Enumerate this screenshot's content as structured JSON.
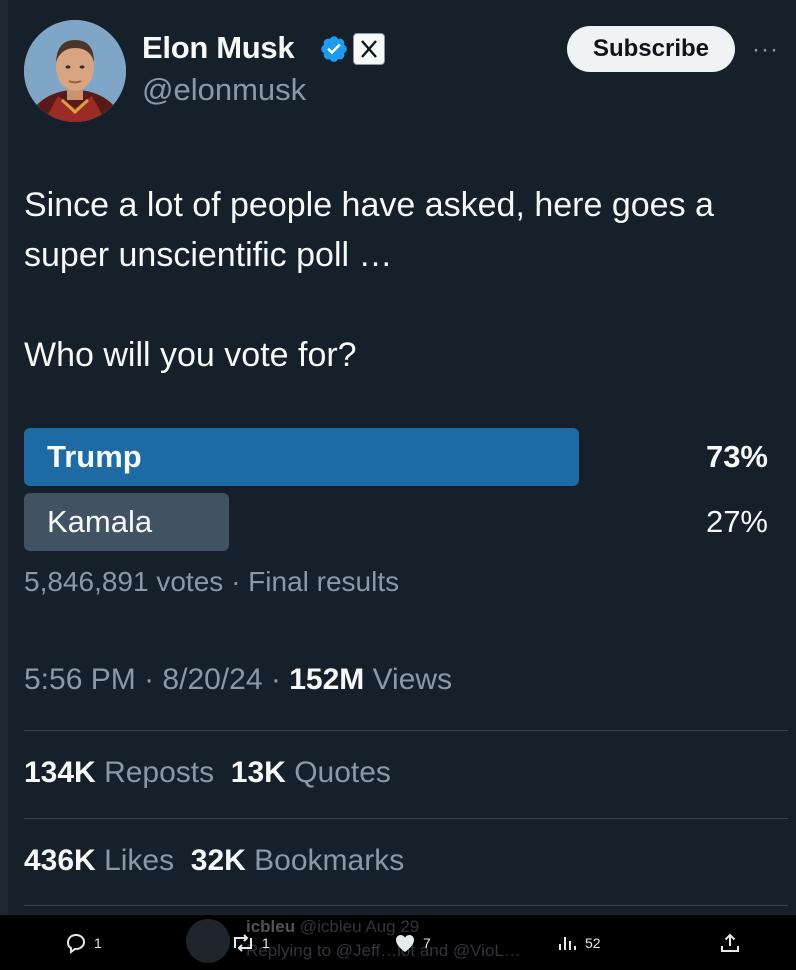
{
  "author": {
    "name": "Elon Musk",
    "handle": "@elonmusk"
  },
  "subscribe_label": "Subscribe",
  "more_label": "···",
  "tweet_text": "Since a lot of people have asked, here goes a super unscientific poll …\n\nWho will you vote for?",
  "poll": {
    "options": [
      {
        "label": "Trump",
        "percent_label": "73%",
        "percent": 73
      },
      {
        "label": "Kamala",
        "percent_label": "27%",
        "percent": 27
      }
    ],
    "votes": "5,846,891 votes",
    "separator": "·",
    "status": "Final results"
  },
  "meta": {
    "time": "5:56 PM",
    "date": "8/20/24",
    "views_count": "152M",
    "views_label": "Views",
    "separator": "·"
  },
  "stats": {
    "reposts_count": "134K",
    "reposts_label": "Reposts",
    "quotes_count": "13K",
    "quotes_label": "Quotes",
    "likes_count": "436K",
    "likes_label": "Likes",
    "bookmarks_count": "32K",
    "bookmarks_label": "Bookmarks"
  },
  "bottom_bar": {
    "reply_count": "1",
    "repost_count": "1",
    "like_count": "7",
    "views_count": "52",
    "preview": {
      "name": "icbleu",
      "handle": "@icbleu",
      "date": "Aug 29",
      "text": "Replying to @Jeff…lot and @VioL…"
    }
  },
  "colors": {
    "background": "#15202b",
    "poll_winner": "#1d6aa5",
    "poll_other": "#415262",
    "text": "#f7f9f9",
    "muted": "#8b98a5",
    "verified": "#1d9bf0"
  }
}
